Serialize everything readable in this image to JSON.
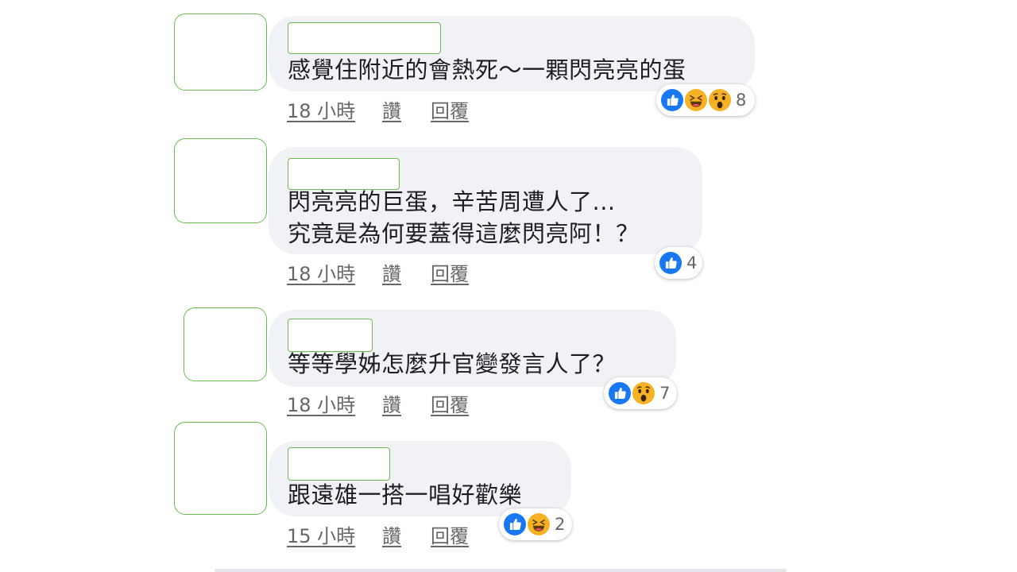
{
  "comments": [
    {
      "text": "感覺住附近的會熱死～一顆閃亮亮的蛋",
      "time": "18 小時",
      "like_label": "讚",
      "reply_label": "回覆",
      "reactions": [
        "like-icon",
        "haha-icon",
        "wow-icon"
      ],
      "reaction_count": "8"
    },
    {
      "text": "閃亮亮的巨蛋，辛苦周遭人了...\n究竟是為何要蓋得這麼閃亮阿！？",
      "time": "18 小時",
      "like_label": "讚",
      "reply_label": "回覆",
      "reactions": [
        "like-icon"
      ],
      "reaction_count": "4"
    },
    {
      "text": "等等學姊怎麼升官變發言人了？",
      "time": "18 小時",
      "like_label": "讚",
      "reply_label": "回覆",
      "reactions": [
        "like-icon",
        "wow-icon"
      ],
      "reaction_count": "7"
    },
    {
      "text": "跟遠雄一搭一唱好歡樂",
      "time": "15 小時",
      "like_label": "讚",
      "reply_label": "回覆",
      "reactions": [
        "like-icon",
        "haha-icon"
      ],
      "reaction_count": "2"
    }
  ],
  "colors": {
    "bubble": "#f0f2f5",
    "redaction_border": "#6cbb4f",
    "like_blue": "#1877f2",
    "emoji_yellow": "#f7b125",
    "meta_gray": "#65676b"
  }
}
